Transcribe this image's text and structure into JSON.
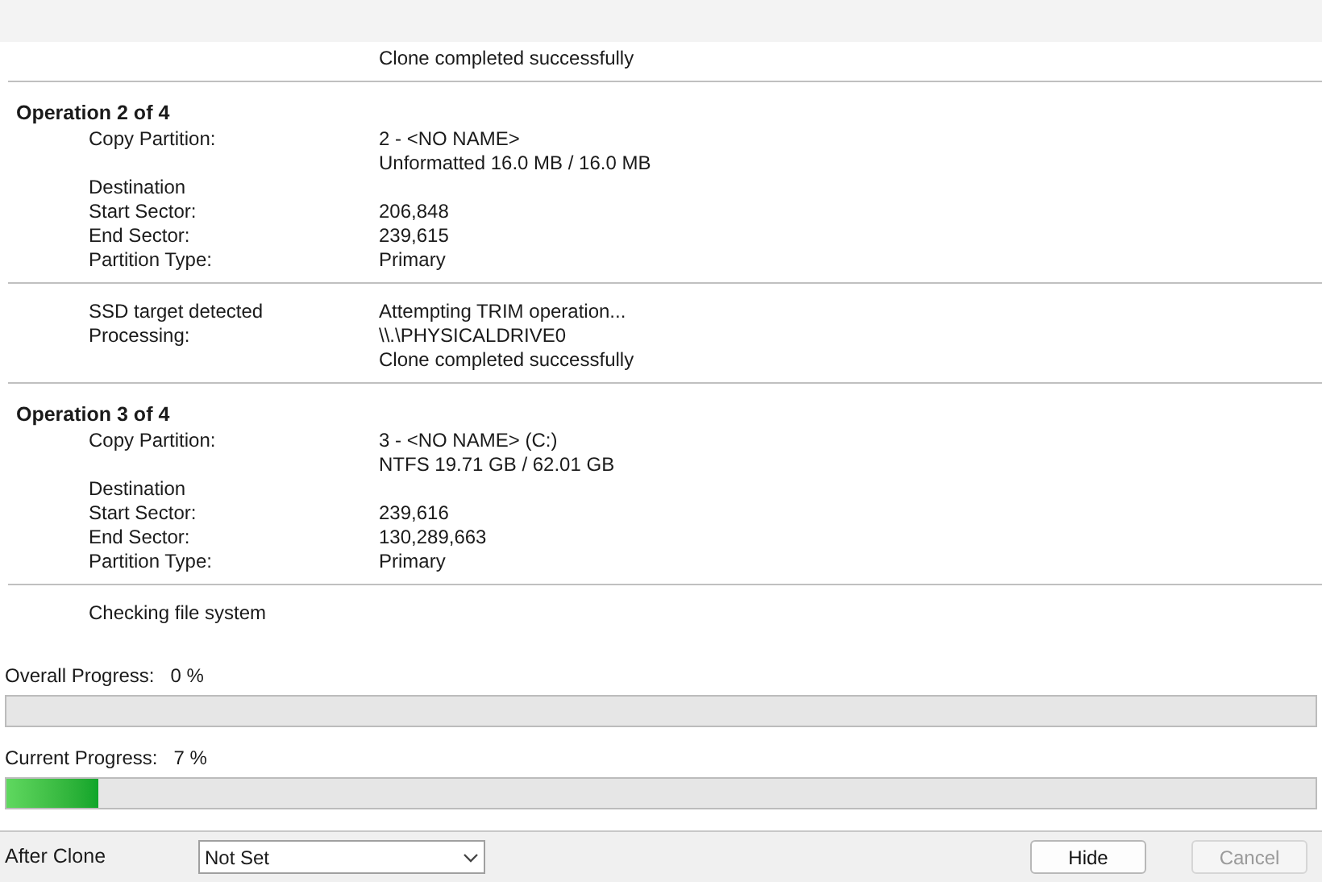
{
  "log_blocks": [
    {
      "rows": [
        {
          "label": "",
          "values": [
            "Clone completed successfully"
          ]
        }
      ]
    },
    {
      "heading": "Operation 2 of 4",
      "rows": [
        {
          "label": "Copy Partition:",
          "values": [
            "2 - <NO NAME>",
            "Unformatted 16.0 MB / 16.0 MB"
          ]
        },
        {
          "label": "Destination",
          "values": []
        },
        {
          "label": "Start Sector:",
          "values": [
            "206,848"
          ]
        },
        {
          "label": "End Sector:",
          "values": [
            "239,615"
          ]
        },
        {
          "label": "Partition Type:",
          "values": [
            "Primary"
          ]
        }
      ]
    },
    {
      "rows": [
        {
          "label": "SSD target detected",
          "values": [
            "Attempting TRIM operation..."
          ]
        },
        {
          "label": "Processing:",
          "values": [
            "\\\\.\\PHYSICALDRIVE0",
            "Clone completed successfully"
          ]
        }
      ]
    },
    {
      "heading": "Operation 3 of 4",
      "rows": [
        {
          "label": "Copy Partition:",
          "values": [
            "3 - <NO NAME> (C:)",
            "NTFS 19.71 GB / 62.01 GB"
          ]
        },
        {
          "label": "Destination",
          "values": []
        },
        {
          "label": "Start Sector:",
          "values": [
            "239,616"
          ]
        },
        {
          "label": "End Sector:",
          "values": [
            "130,289,663"
          ]
        },
        {
          "label": "Partition Type:",
          "values": [
            "Primary"
          ]
        }
      ]
    },
    {
      "rows": [
        {
          "label": "Checking file system",
          "values": []
        }
      ]
    }
  ],
  "progress": [
    {
      "label": "Overall Progress:",
      "reading": "0 %",
      "level": 0
    },
    {
      "label": "Current Progress:",
      "reading": "7 %",
      "level": 0.07
    }
  ],
  "footer": {
    "label": "After Clone",
    "dropdown": "Not Set",
    "buttons": [
      {
        "label": "Hide",
        "disabled": false
      },
      {
        "label": "Cancel",
        "disabled": true
      }
    ]
  }
}
